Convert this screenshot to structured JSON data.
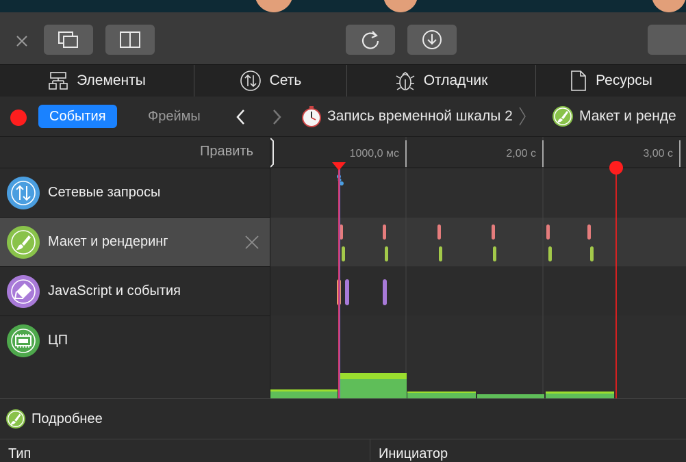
{
  "toolbar": {
    "buttons": [
      {
        "name": "close-icon"
      },
      {
        "name": "detach-window-icon"
      },
      {
        "name": "split-view-icon"
      },
      {
        "name": "reload-icon"
      },
      {
        "name": "download-icon"
      }
    ]
  },
  "tabs": [
    {
      "label": "Элементы",
      "icon": "elements-icon"
    },
    {
      "label": "Сеть",
      "icon": "network-icon"
    },
    {
      "label": "Отладчик",
      "icon": "debugger-icon"
    },
    {
      "label": "Ресурсы",
      "icon": "resources-icon"
    }
  ],
  "timeline": {
    "record_color": "#ff1e1e",
    "active_tab": "События",
    "inactive_tab": "Фреймы",
    "breadcrumb_recording": "Запись временной шкалы 2",
    "breadcrumb_current": "Макет и ренде"
  },
  "left": {
    "edit_label": "Править",
    "rows": [
      {
        "label": "Сетевые запросы",
        "icon": "network-requests-icon",
        "color": "#4a9ee0"
      },
      {
        "label": "Макет и рендеринг",
        "icon": "layout-rendering-icon",
        "color": "#89c24a"
      },
      {
        "label": "JavaScript и события",
        "icon": "javascript-events-icon",
        "color": "#a87ad8"
      },
      {
        "label": "ЦП",
        "icon": "cpu-icon",
        "color": "#4ea84c"
      }
    ]
  },
  "ruler": {
    "ticks": [
      "1000,0 мс",
      "2,00 с",
      "3,00 с"
    ]
  },
  "bottom": {
    "details_label": "Подробнее",
    "col_type": "Тип",
    "col_initiator": "Инициатор"
  },
  "colors": {
    "accent": "#1a82ff",
    "marker": "#ff1e1e",
    "cpu": "#5fbe59",
    "cpu_top": "#9bde2f"
  }
}
